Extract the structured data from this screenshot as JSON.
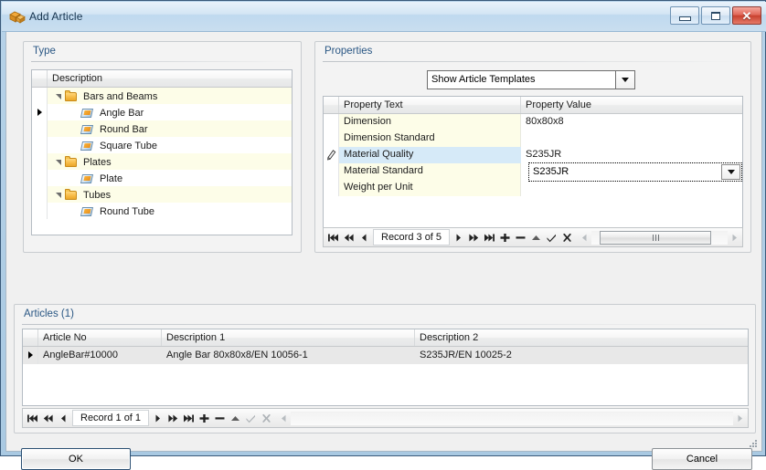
{
  "window": {
    "title": "Add Article",
    "icon": "article-box-icon",
    "controls": {
      "minimize": "minimize-button",
      "maximize": "maximize-button",
      "close": "close-button",
      "close_glyph": "✕"
    }
  },
  "type_panel": {
    "legend": "Type",
    "column_header": "Description",
    "rows": [
      {
        "label": "Bars and Beams",
        "kind": "folder",
        "level": 0,
        "expanded": true,
        "alt": true,
        "selected": false
      },
      {
        "label": "Angle Bar",
        "kind": "item",
        "level": 1,
        "expanded": false,
        "alt": false,
        "selected": true
      },
      {
        "label": "Round Bar",
        "kind": "item",
        "level": 1,
        "expanded": false,
        "alt": true,
        "selected": false
      },
      {
        "label": "Square Tube",
        "kind": "item",
        "level": 1,
        "expanded": false,
        "alt": false,
        "selected": false
      },
      {
        "label": "Plates",
        "kind": "folder",
        "level": 0,
        "expanded": true,
        "alt": true,
        "selected": false
      },
      {
        "label": "Plate",
        "kind": "item",
        "level": 1,
        "expanded": false,
        "alt": false,
        "selected": false
      },
      {
        "label": "Tubes",
        "kind": "folder",
        "level": 0,
        "expanded": true,
        "alt": true,
        "selected": false
      },
      {
        "label": "Round Tube",
        "kind": "item",
        "level": 1,
        "expanded": false,
        "alt": false,
        "selected": false
      }
    ]
  },
  "properties_panel": {
    "legend": "Properties",
    "template_combo": {
      "value": "Show Article Templates",
      "options": [
        "Show Article Templates"
      ]
    },
    "columns": [
      "Property Text",
      "Property Value"
    ],
    "rows": [
      {
        "text": "Dimension",
        "value": "80x80x8",
        "alt": true,
        "editing": false
      },
      {
        "text": "Dimension Standard",
        "value": "",
        "alt": true,
        "editing": false
      },
      {
        "text": "Material Quality",
        "value": "S235JR",
        "alt": false,
        "editing": true
      },
      {
        "text": "Material Standard",
        "value": "",
        "alt": true,
        "editing": false
      },
      {
        "text": "Weight per Unit",
        "value": "",
        "alt": true,
        "editing": false
      }
    ],
    "editor_value": "S235JR",
    "navigator": {
      "record_label": "Record 3 of 5",
      "buttons": [
        "first-record",
        "prior-page",
        "prior-record",
        "next-record",
        "next-page",
        "last-record",
        "insert-record",
        "delete-record",
        "edit-record",
        "post-edit",
        "cancel-edit"
      ],
      "scrollbar": true
    }
  },
  "articles_panel": {
    "legend": "Articles (1)",
    "columns": [
      "Article No",
      "Description 1",
      "Description 2"
    ],
    "rows": [
      {
        "article_no": "AngleBar#10000",
        "description_1": "Angle Bar 80x80x8/EN 10056-1",
        "description_2": "S235JR/EN 10025-2",
        "selected": true
      }
    ],
    "navigator": {
      "record_label": "Record 1 of 1",
      "buttons": [
        "first-record",
        "prior-page",
        "prior-record",
        "next-record",
        "next-page",
        "last-record",
        "insert-record",
        "delete-record",
        "edit-record",
        "post-edit",
        "cancel-edit"
      ],
      "scrollbar": true
    }
  },
  "footer": {
    "ok_label": "OK",
    "cancel_label": "Cancel"
  },
  "colors": {
    "titlebar_text": "#16334d",
    "group_legend": "#2a5784",
    "row_alt": "#fdfde8",
    "row_selected": "#d6eaf8",
    "close_button": "#c8412f",
    "folder_icon": "#f5b942"
  }
}
